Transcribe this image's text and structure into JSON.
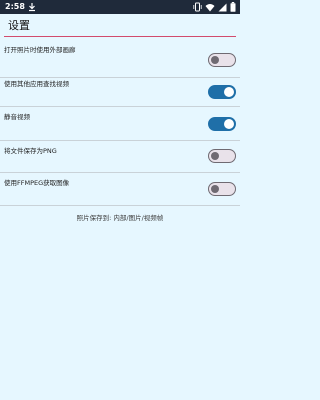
{
  "status_bar": {
    "time": "2:58",
    "icons": [
      "download-icon",
      "vibrate-icon",
      "wifi-icon",
      "signal-icon",
      "battery-icon"
    ]
  },
  "header": {
    "title": "设置",
    "accent_color": "#d24b6d"
  },
  "settings": [
    {
      "label": "打开照片时使用外部画廊",
      "enabled": false
    },
    {
      "label": "使用其他应用查找视频",
      "enabled": true
    },
    {
      "label": "静音视频",
      "enabled": true
    },
    {
      "label": "将文件保存为PNG",
      "enabled": false
    },
    {
      "label": "使用FFMPEG获取图像",
      "enabled": false
    }
  ],
  "footer": {
    "save_location": "照片保存到: 内部/图片/视频帧"
  },
  "colors": {
    "background": "#e6f7ff",
    "switch_on": "#1f6fa8",
    "switch_off_track": "#e9e2ea",
    "switch_off_outline": "#6f6a72"
  }
}
